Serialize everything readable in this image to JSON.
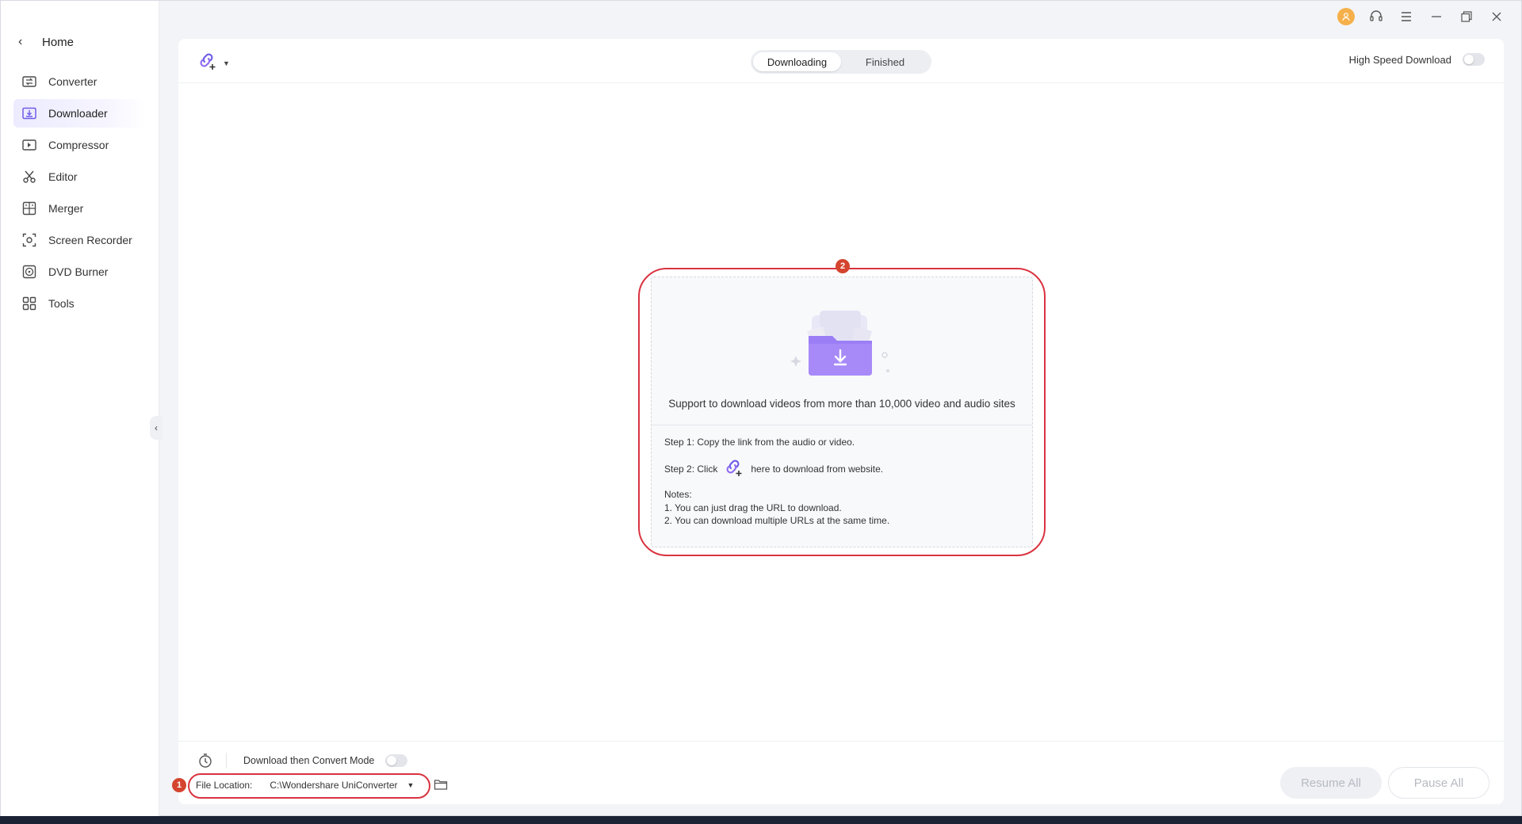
{
  "sidebar": {
    "home_label": "Home",
    "items": [
      {
        "label": "Converter",
        "icon": "converter-icon"
      },
      {
        "label": "Downloader",
        "icon": "downloader-icon",
        "active": true
      },
      {
        "label": "Compressor",
        "icon": "compressor-icon"
      },
      {
        "label": "Editor",
        "icon": "scissors-icon"
      },
      {
        "label": "Merger",
        "icon": "merger-icon"
      },
      {
        "label": "Screen Recorder",
        "icon": "screen-recorder-icon"
      },
      {
        "label": "DVD Burner",
        "icon": "dvd-icon"
      },
      {
        "label": "Tools",
        "icon": "tools-grid-icon"
      }
    ]
  },
  "header": {
    "tabs": [
      {
        "label": "Downloading",
        "active": true
      },
      {
        "label": "Finished",
        "active": false
      }
    ],
    "high_speed_label": "High Speed Download",
    "high_speed_on": false
  },
  "center": {
    "badge": "2",
    "support_text": "Support to download videos from more than 10,000 video and audio sites",
    "step1": "Step 1: Copy the link from the audio or video.",
    "step2_prefix": "Step 2: Click",
    "step2_suffix": "here to download from website.",
    "notes_title": "Notes:",
    "note1": "1. You can just drag the URL to download.",
    "note2": "2. You can download multiple URLs at the same time."
  },
  "bottom": {
    "convert_mode_label": "Download then Convert Mode",
    "convert_mode_on": false,
    "badge": "1",
    "file_location_label": "File Location:",
    "file_location_value": "C:\\Wondershare UniConverter ",
    "resume_all": "Resume All",
    "pause_all": "Pause All"
  },
  "colors": {
    "accent": "#6d5ce8",
    "highlight": "#d9333f",
    "badge": "#d4442f",
    "avatar": "#f6b04a"
  }
}
